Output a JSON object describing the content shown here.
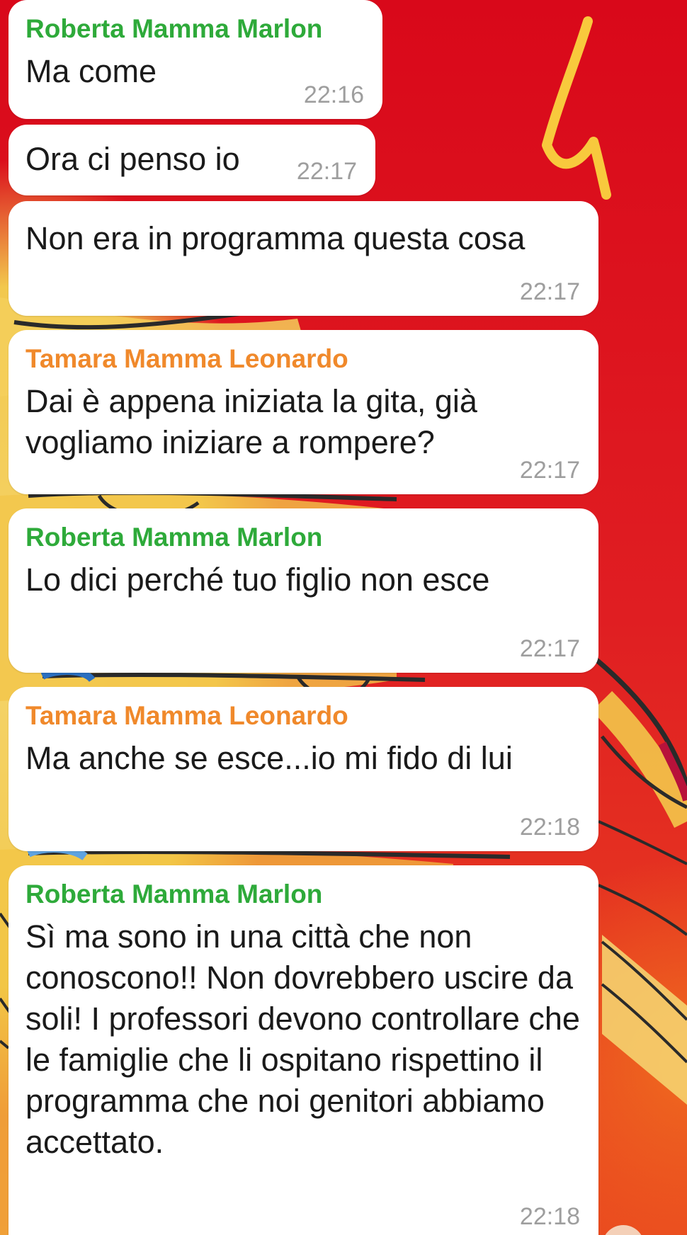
{
  "colors": {
    "sender_green": "#2eaa3a",
    "sender_orange": "#f0892b",
    "time_gray": "#9e9e9e",
    "bubble_bg": "#ffffff"
  },
  "messages": [
    {
      "sender": "Roberta Mamma Marlon",
      "text": "Ma come",
      "time": "22:16"
    },
    {
      "sender": "",
      "text": "Ora ci penso io",
      "time": "22:17"
    },
    {
      "sender": "",
      "text": "Non era in programma questa cosa",
      "time": "22:17"
    },
    {
      "sender": "Tamara Mamma Leonardo",
      "text": "Dai è appena iniziata la gita, già vogliamo iniziare a rompere?",
      "time": "22:17"
    },
    {
      "sender": "Roberta Mamma Marlon",
      "text": "Lo dici perché tuo figlio non esce",
      "time": "22:17"
    },
    {
      "sender": "Tamara Mamma Leonardo",
      "text": "Ma anche se esce...io mi fido di lui",
      "time": "22:18"
    },
    {
      "sender": "Roberta Mamma Marlon",
      "text": "Sì ma sono in una città che non conoscono!! Non dovrebbero uscire da soli! I professori devono controllare che le famiglie che li ospitano rispettino il programma che noi genitori abbiamo accettato.",
      "time": "22:18"
    }
  ]
}
